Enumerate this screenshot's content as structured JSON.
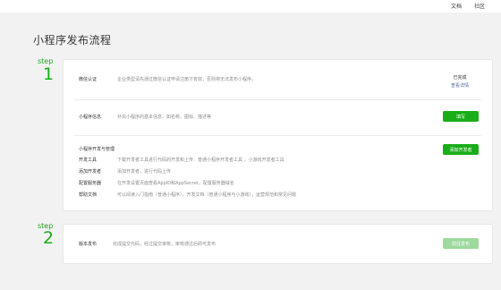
{
  "topnav": {
    "docs": "文档",
    "community": "社区"
  },
  "page_title": "小程序发布流程",
  "step1": {
    "step_label": "step",
    "step_number": "1",
    "verify": {
      "label": "微信认证",
      "desc": "企业类型请先通过微信认证申请注册才有效，否则将无法发布小程序。",
      "status": "已完成",
      "detail_link": "查看详情"
    },
    "info": {
      "label": "小程序信息",
      "desc": "补充小程序的基本信息，如名称、图标、描述等",
      "button": "填写"
    },
    "dev": {
      "section_title": "小程序开发与管理",
      "add_dev_button": "添加开发者",
      "items": [
        {
          "label": "开发工具",
          "desc": "下载开发者工具进行代码的开发和上传：普通小程序开发者工具 ，小游戏开发者工具"
        },
        {
          "label": "添加开发者",
          "desc": "添加开发者，进行代码上传"
        },
        {
          "label": "配置服务器",
          "desc": "在开发设置页面查看AppID和AppSecret，配置服务器域名"
        },
        {
          "label": "帮助文档",
          "desc": "可以阅读入门指南（普通小程序），开发文档（普通小程序与小游戏），运营规范和常见问题"
        }
      ]
    }
  },
  "step2": {
    "step_label": "step",
    "step_number": "2",
    "publish": {
      "label": "版本发布",
      "desc": "完成提交代码，经过提交审核，审核通过后即可发布",
      "button": "前往发布"
    }
  }
}
